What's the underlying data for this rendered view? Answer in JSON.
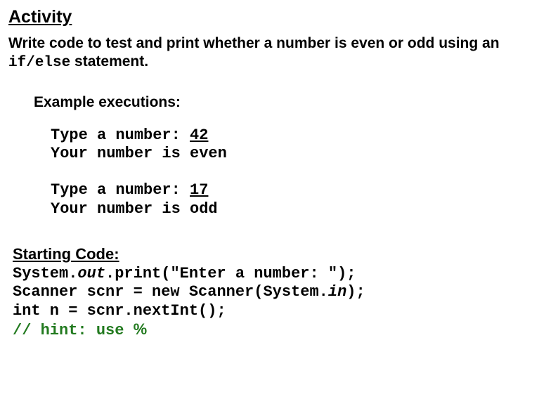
{
  "title": "Activity",
  "instruction": {
    "part1": "Write code to test and print whether a number is even or odd using an ",
    "code": "if/else",
    "part2": " statement."
  },
  "example_heading": "Example executions:",
  "examples": [
    {
      "prompt": "Type a number: ",
      "input": "42",
      "result": "Your number is even"
    },
    {
      "prompt": "Type a number: ",
      "input": "17",
      "result": "Your number is odd"
    }
  ],
  "starting_heading": "Starting Code:",
  "code": {
    "l1a": "System.",
    "l1b": "out",
    "l1c": ".print(\"Enter a number: \");",
    "l2a": "Scanner scnr = new Scanner(System.",
    "l2b": "in",
    "l2c": ");",
    "l3": "int n = scnr.nextInt();",
    "l4a": "// hint: use ",
    "l4b": "%"
  }
}
